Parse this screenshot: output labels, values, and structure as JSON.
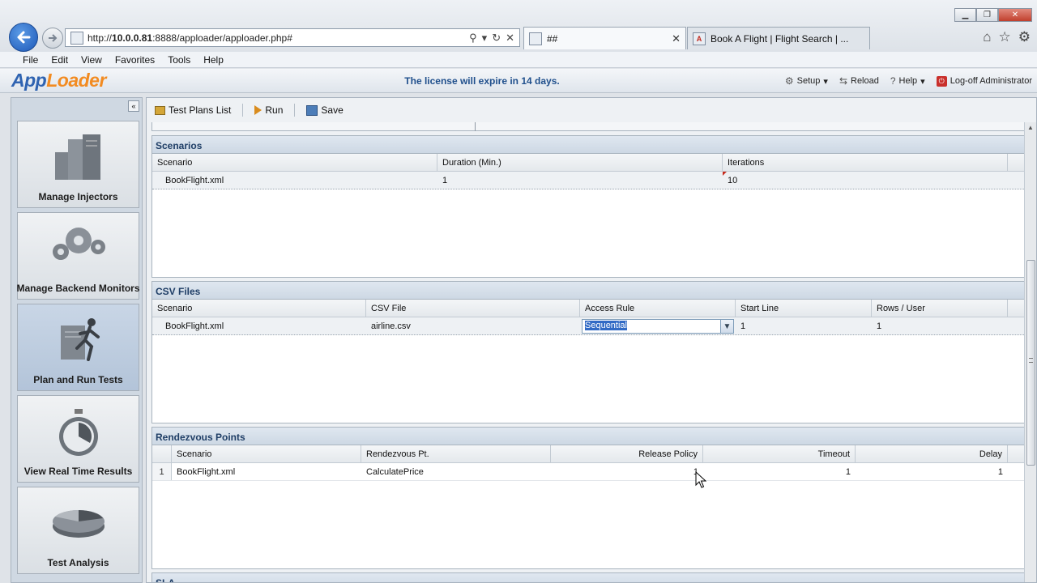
{
  "browser": {
    "url_prefix": "http://",
    "url_host": "10.0.0.81",
    "url_rest": ":8888/apploader/apploader.php#",
    "tabs": [
      {
        "label": "##"
      },
      {
        "label": "Book A Flight | Flight Search | ..."
      }
    ],
    "menu": [
      "File",
      "Edit",
      "View",
      "Favorites",
      "Tools",
      "Help"
    ]
  },
  "header": {
    "logo_app": "App",
    "logo_loader": "Loader",
    "license_text": "The license will expire in 14 days.",
    "actions": {
      "setup": "Setup",
      "reload": "Reload",
      "help": "Help",
      "logoff": "Log-off Administrator"
    }
  },
  "sidebar": {
    "items": [
      {
        "label": "Manage Injectors",
        "icon": "server-icon"
      },
      {
        "label": "Manage Backend Monitors",
        "icon": "gears-icon"
      },
      {
        "label": "Plan and Run Tests",
        "icon": "runner-icon",
        "active": true
      },
      {
        "label": "View Real Time Results",
        "icon": "stopwatch-icon"
      },
      {
        "label": "Test Analysis",
        "icon": "pie-chart-icon"
      }
    ]
  },
  "toolbar": {
    "test_plans_list": "Test Plans List",
    "run": "Run",
    "save": "Save"
  },
  "scenarios": {
    "title": "Scenarios",
    "columns": [
      "Scenario",
      "Duration (Min.)",
      "Iterations"
    ],
    "rows": [
      {
        "scenario": "BookFlight.xml",
        "duration": "1",
        "iterations": "10"
      }
    ]
  },
  "csv_files": {
    "title": "CSV Files",
    "columns": [
      "Scenario",
      "CSV File",
      "Access Rule",
      "Start Line",
      "Rows / User"
    ],
    "rows": [
      {
        "scenario": "BookFlight.xml",
        "csv_file": "airline.csv",
        "access_rule": "Sequential",
        "start_line": "1",
        "rows_per_user": "1"
      }
    ]
  },
  "rendezvous": {
    "title": "Rendezvous Points",
    "columns": [
      "Scenario",
      "Rendezvous Pt.",
      "Release Policy",
      "Timeout",
      "Delay"
    ],
    "rows": [
      {
        "num": "1",
        "scenario": "BookFlight.xml",
        "point": "CalculatePrice",
        "release_policy": "1",
        "timeout": "1",
        "delay": "1"
      }
    ]
  },
  "sla": {
    "title": "SLA"
  }
}
